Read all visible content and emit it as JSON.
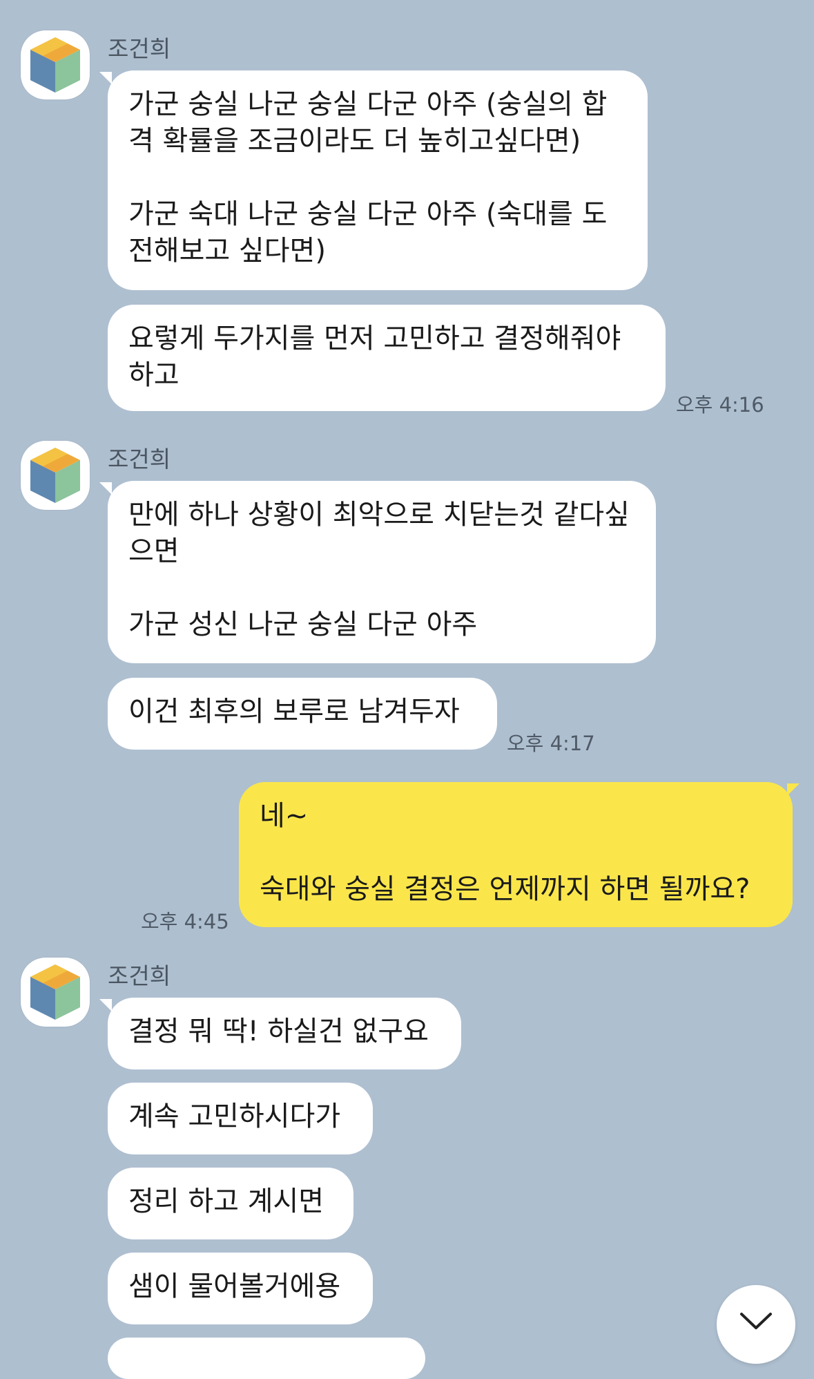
{
  "chat": {
    "group1": {
      "sender": "조건희",
      "messages": [
        "가군 숭실 나군 숭실 다군 아주 (숭실의 합격 확률을 조금이라도 더 높히고싶다면)\n\n가군 숙대 나군 숭실 다군 아주 (숙대를 도전해보고 싶다면)",
        "요렇게 두가지를 먼저 고민하고 결정해줘야하고"
      ],
      "time": "오후 4:16"
    },
    "group2": {
      "sender": "조건희",
      "messages": [
        "만에 하나 상황이 최악으로 치닫는것 같다싶으면\n\n가군 성신 나군 숭실 다군 아주",
        "이건 최후의 보루로 남겨두자"
      ],
      "time": "오후 4:17"
    },
    "mine": {
      "message": "네~\n\n숙대와 숭실 결정은 언제까지 하면 될까요?",
      "time": "오후 4:45"
    },
    "group3": {
      "sender": "조건희",
      "messages": [
        "결정 뭐 딱! 하실건 없구요",
        "계속 고민하시다가",
        "정리 하고 계시면",
        "샘이 물어볼거에용"
      ]
    }
  },
  "icons": {
    "avatar": "colored-cube-icon",
    "scroll_down": "chevron-down-icon"
  },
  "colors": {
    "background": "#aebfd0",
    "incoming_bubble": "#ffffff",
    "outgoing_bubble": "#fae64b"
  }
}
